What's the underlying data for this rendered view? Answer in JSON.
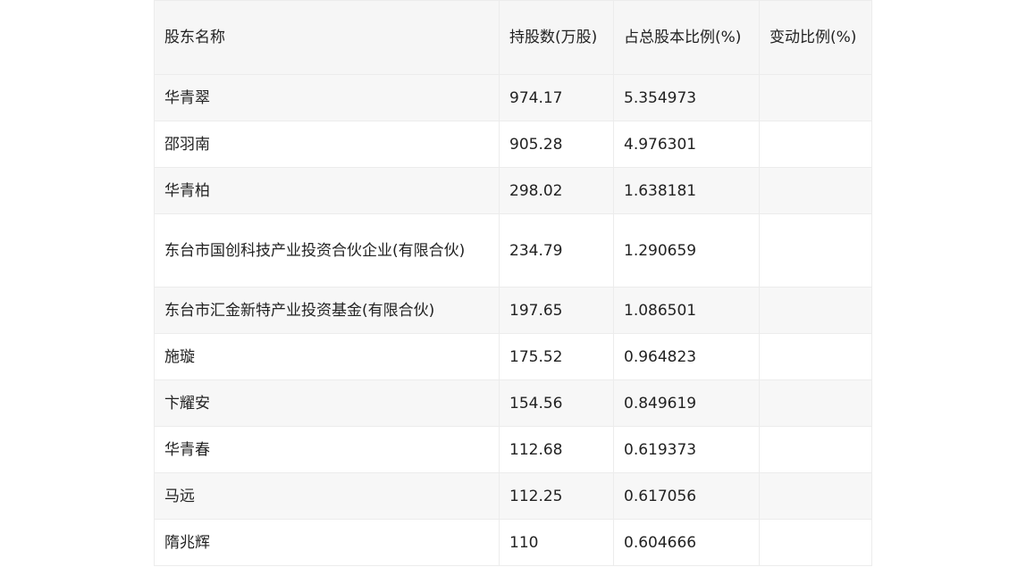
{
  "table": {
    "headers": [
      "股东名称",
      "持股数(万股)",
      "占总股本比例(%)",
      "变动比例(%)"
    ],
    "rows": [
      [
        "华青翠",
        "974.17",
        "5.354973",
        ""
      ],
      [
        "邵羽南",
        "905.28",
        "4.976301",
        ""
      ],
      [
        "华青柏",
        "298.02",
        "1.638181",
        ""
      ],
      [
        "东台市国创科技产业投资合伙企业(有限合伙)",
        "234.79",
        "1.290659",
        ""
      ],
      [
        "东台市汇金新特产业投资基金(有限合伙)",
        "197.65",
        "1.086501",
        ""
      ],
      [
        "施璇",
        "175.52",
        "0.964823",
        ""
      ],
      [
        "卞耀安",
        "154.56",
        "0.849619",
        ""
      ],
      [
        "华青春",
        "112.68",
        "0.619373",
        ""
      ],
      [
        "马远",
        "112.25",
        "0.617056",
        ""
      ],
      [
        "隋兆辉",
        "110",
        "0.604666",
        ""
      ]
    ]
  }
}
